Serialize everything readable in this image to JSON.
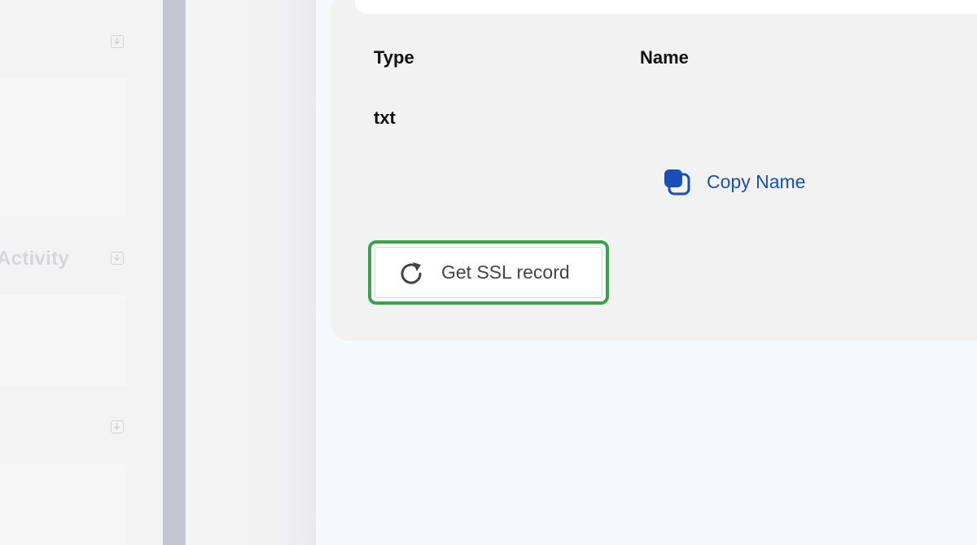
{
  "sidebar": {
    "items": [
      {
        "label": ""
      },
      {
        "label": "Activity"
      },
      {
        "label": ""
      }
    ]
  },
  "record_table": {
    "headers": {
      "type": "Type",
      "name": "Name"
    },
    "rows": [
      {
        "type": "txt",
        "name": ""
      }
    ]
  },
  "actions": {
    "copy_name_label": "Copy Name",
    "get_ssl_label": "Get SSL record"
  },
  "icons": {
    "copy": "copy-icon",
    "refresh": "refresh-icon",
    "download": "download-icon"
  },
  "colors": {
    "link_blue": "#1a4fba",
    "highlight_green": "#3aa24a",
    "divider": "#c6c6d2"
  }
}
